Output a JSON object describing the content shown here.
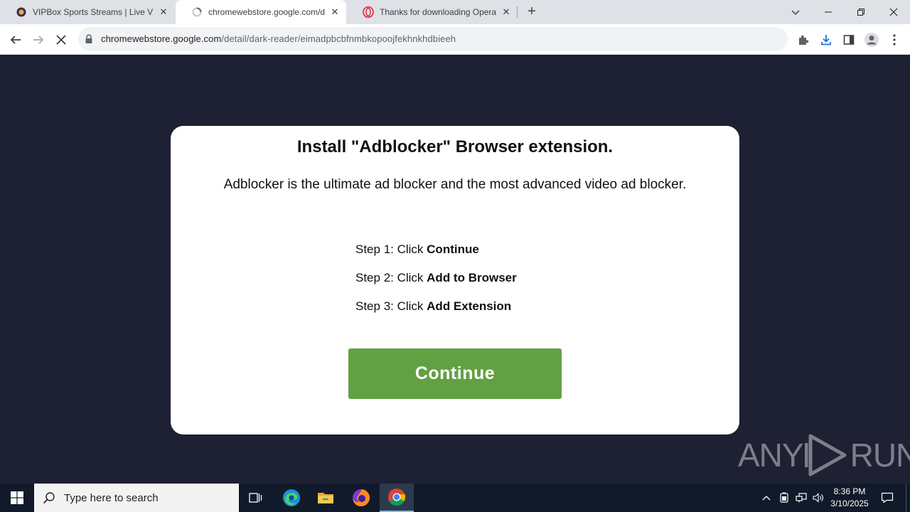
{
  "tabs": [
    {
      "title": "VIPBox Sports Streams | Live VIPBox",
      "favicon": "vipbox-icon",
      "active": false
    },
    {
      "title": "chromewebstore.google.com/detail/dark-reader",
      "favicon": "chrome-loading-icon",
      "active": true
    },
    {
      "title": "Thanks for downloading Opera",
      "favicon": "opera-icon",
      "active": false
    }
  ],
  "tab_close_glyph": "✕",
  "new_tab_glyph": "+",
  "address_bar": {
    "host": "chromewebstore.google.com",
    "path": "/detail/dark-reader/eimadpbcbfnmbkopoojfekhnkhdbieeh"
  },
  "dialog": {
    "title": "Install \"Adblocker\" Browser extension.",
    "description": "Adblocker is the ultimate ad blocker and the most advanced video ad blocker.",
    "steps": [
      {
        "prefix": "Step 1: Click ",
        "action": "Continue"
      },
      {
        "prefix": "Step 2: Click ",
        "action": "Add to Browser"
      },
      {
        "prefix": "Step 3: Click ",
        "action": "Add Extension"
      }
    ],
    "continue_label": "Continue"
  },
  "watermark": {
    "text1": "ANY",
    "text2": "RUN"
  },
  "taskbar": {
    "search_placeholder": "Type here to search",
    "time": "8:36 PM",
    "date": "3/10/2025"
  },
  "colors": {
    "page_bg": "#1e2033",
    "continue_button": "#62a044",
    "taskbar": "#101a2a"
  }
}
